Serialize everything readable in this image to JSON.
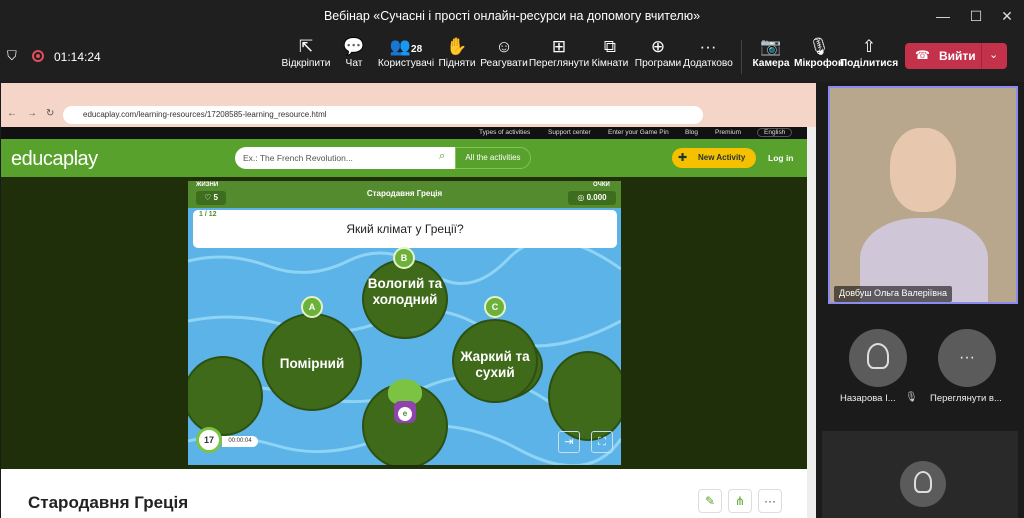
{
  "window": {
    "title": "Вебінар «Сучасні і прості онлайн-ресурси на допомогу вчителю»"
  },
  "meeting": {
    "timer": "01:14:24",
    "participants_count": "28"
  },
  "toolbar": {
    "unpin": "Відкріпити",
    "chat": "Чат",
    "users": "Користувачі",
    "raise": "Підняти",
    "react": "Реагувати",
    "view": "Переглянути",
    "rooms": "Кімнати",
    "apps": "Програми",
    "more": "Додатково",
    "camera": "Камера",
    "mic": "Мікрофон",
    "share": "Поділитися",
    "leave": "Вийти"
  },
  "browser": {
    "url": "educaplay.com/learning-resources/17208585-learning_resource.html"
  },
  "educaplay": {
    "top_links": [
      "Types of activities",
      "Support center",
      "Enter your Game Pin",
      "Blog",
      "Premium"
    ],
    "language": "English",
    "logo": "educaplay",
    "search_placeholder": "Ex.: The French Revolution...",
    "all_activities": "All the activities",
    "new_activity": "New Activity",
    "login": "Log in"
  },
  "game": {
    "lives_label": "ЖИЗНИ",
    "lives": "5",
    "title": "Стародавня Греція",
    "points_label": "ОЧКИ",
    "points": "0.000",
    "progress": "1 / 12",
    "question": "Який клімат у Греції?",
    "answers": [
      {
        "letter": "A",
        "text": "Помірний"
      },
      {
        "letter": "B",
        "text": "Вологий та холодний"
      },
      {
        "letter": "C",
        "text": "Жаркий та сухий"
      }
    ],
    "timer_seconds": "17",
    "elapsed": "00:00:04"
  },
  "page": {
    "title": "Стародавня Греція"
  },
  "participants": {
    "speaker": "Довбуш Ольга Валеріївна",
    "p1": "Назарова І...",
    "p2": "Переглянути в..."
  },
  "colors": {
    "accent": "#58a12c",
    "leave": "#c4314b",
    "pad": "#3f6a1a",
    "water": "#5bb3e8"
  }
}
